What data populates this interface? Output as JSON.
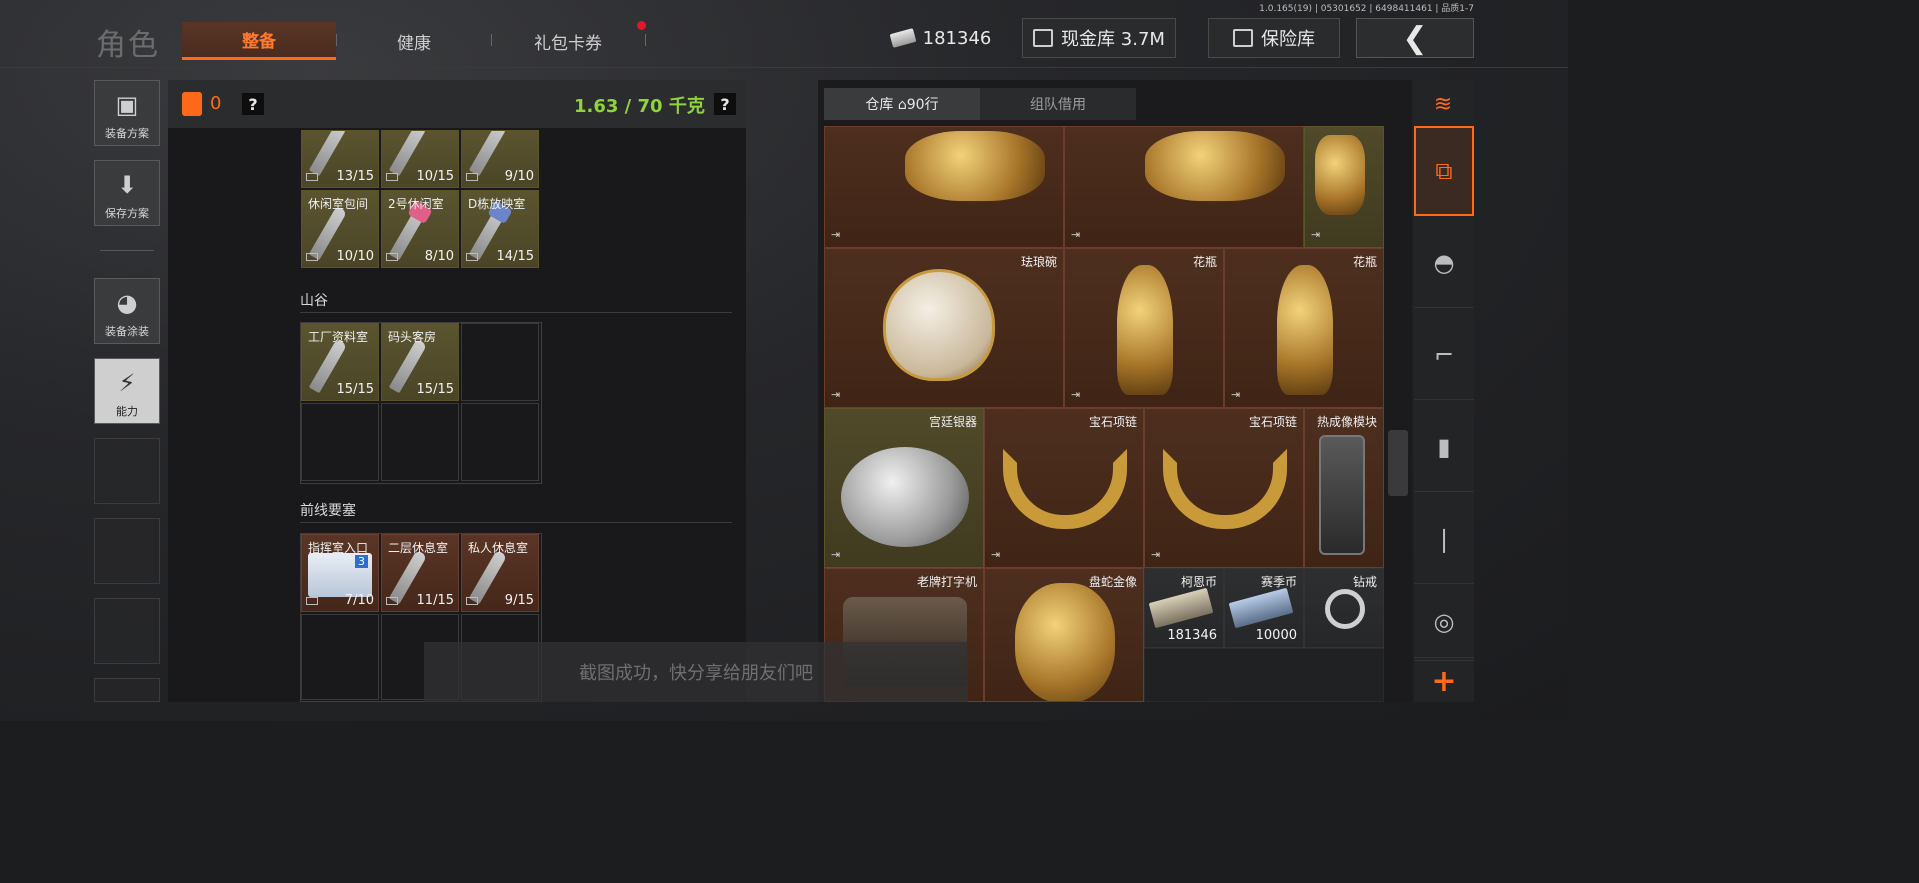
{
  "header": {
    "title": "角色",
    "tabs": [
      {
        "label": "整备",
        "active": true
      },
      {
        "label": "健康",
        "active": false
      },
      {
        "label": "礼包卡券",
        "active": false,
        "notification": true
      }
    ],
    "version": "1.0.165(19) | 05301652 | 6498411461 | 品质1-7",
    "koen_balance": "181346",
    "cash_vault": "现金库 3.7M",
    "safe": "保险库"
  },
  "sidebar": {
    "items": [
      {
        "label": "装备方案",
        "icon": "vest-icon"
      },
      {
        "label": "保存方案",
        "icon": "download-icon"
      },
      {
        "label": "装备涂装",
        "icon": "helmet-icon"
      },
      {
        "label": "能力",
        "icon": "lightning-icon"
      }
    ]
  },
  "left_panel": {
    "bag_count": "0",
    "help": "?",
    "weight": "1.63 / 70 千克",
    "top_row": [
      {
        "name": "",
        "count": "13/15"
      },
      {
        "name": "",
        "count": "10/15"
      },
      {
        "name": "",
        "count": "9/10"
      }
    ],
    "row2": [
      {
        "name": "休闲室包间",
        "count": "10/10"
      },
      {
        "name": "2号休闲室",
        "count": "8/10"
      },
      {
        "name": "D栋放映室",
        "count": "14/15"
      }
    ],
    "sections": [
      {
        "title": "山谷",
        "keys": [
          {
            "name": "工厂资料室",
            "count": "15/15"
          },
          {
            "name": "码头客房",
            "count": "15/15"
          }
        ]
      },
      {
        "title": "前线要塞",
        "keys": [
          {
            "name": "指挥室入口",
            "count": "7/10"
          },
          {
            "name": "二层休息室",
            "count": "11/15"
          },
          {
            "name": "私人休息室",
            "count": "9/15"
          }
        ]
      }
    ]
  },
  "toast": "截图成功，快分享给朋友们吧",
  "stash": {
    "tabs": [
      {
        "label": "仓库 ⌂90行",
        "active": true
      },
      {
        "label": "组队借用",
        "active": false
      }
    ],
    "items": [
      {
        "name": "珐琅碗"
      },
      {
        "name": "花瓶"
      },
      {
        "name": "花瓶"
      },
      {
        "name": "宫廷银器"
      },
      {
        "name": "宝石项链"
      },
      {
        "name": "宝石项链"
      },
      {
        "name": "热成像模块"
      },
      {
        "name": "老牌打字机"
      },
      {
        "name": "盘蛇金像"
      },
      {
        "name": "柯恩币",
        "count": "181346"
      },
      {
        "name": "赛季币",
        "count": "10000"
      },
      {
        "name": "钻戒"
      }
    ]
  },
  "categories": [
    {
      "icon": "refresh-stack-icon"
    },
    {
      "icon": "all-items-icon",
      "active": true
    },
    {
      "icon": "helmet-icon"
    },
    {
      "icon": "rifle-icon"
    },
    {
      "icon": "magazine-icon"
    },
    {
      "icon": "ammo-icon"
    },
    {
      "icon": "scope-icon"
    },
    {
      "icon": "plus-icon"
    }
  ],
  "colors": {
    "accent": "#ff6a1a",
    "weight_green": "#8fd43a",
    "notification": "#e0182a"
  }
}
